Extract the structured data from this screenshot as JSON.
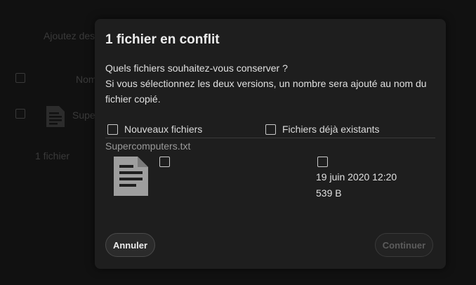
{
  "background": {
    "hint": "Ajoutez des",
    "column_name": "Nom",
    "file_name": "Supe",
    "footer": "1 fichier"
  },
  "dialog": {
    "title": "1 fichier en conflit",
    "question": "Quels fichiers souhaitez-vous conserver ?",
    "explanation": "Si vous sélectionnez les deux versions, un nombre sera ajouté au nom du fichier copié.",
    "new_files_label": "Nouveaux fichiers",
    "existing_files_label": "Fichiers déjà existants",
    "file": {
      "name": "Supercomputers.txt",
      "existing_date": "19 juin 2020 12:20",
      "existing_size": "539 B"
    },
    "cancel_label": "Annuler",
    "continue_label": "Continuer"
  },
  "colors": {
    "dialog_bg": "#1e1e1e",
    "page_bg": "#0f0f0f",
    "file_icon": "#9e9e9e"
  }
}
